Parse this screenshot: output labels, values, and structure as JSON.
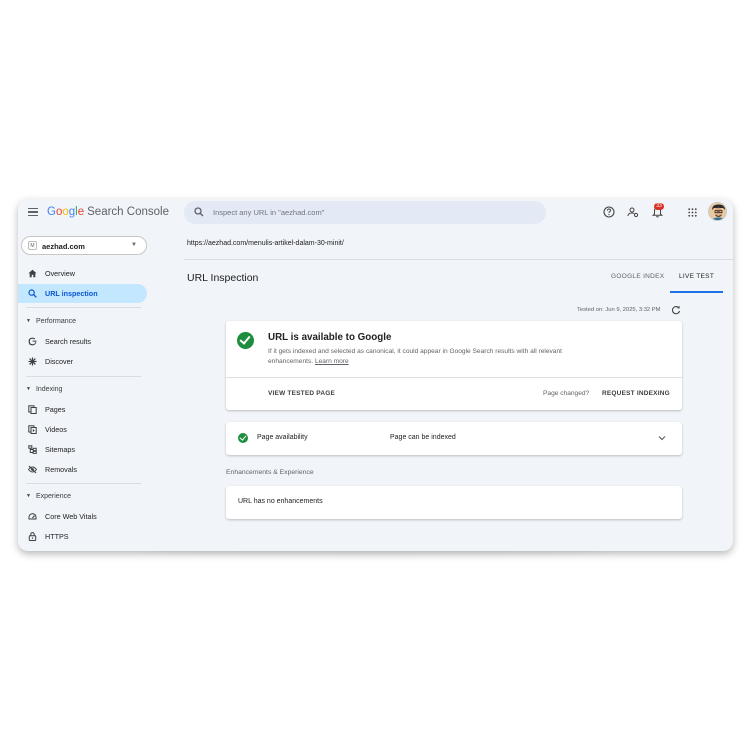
{
  "header": {
    "logo_letters": [
      "G",
      "o",
      "o",
      "g",
      "l",
      "e"
    ],
    "logo_product": "Search Console",
    "search_placeholder": "Inspect any URL in \"aezhad.com\"",
    "notification_count": "33"
  },
  "sidebar": {
    "property": "aezhad.com",
    "property_icon_letter": "M",
    "items": [
      {
        "label": "Overview"
      },
      {
        "label": "URL inspection"
      }
    ],
    "sections": [
      {
        "label": "Performance",
        "items": [
          {
            "label": "Search results"
          },
          {
            "label": "Discover"
          }
        ]
      },
      {
        "label": "Indexing",
        "items": [
          {
            "label": "Pages"
          },
          {
            "label": "Videos"
          },
          {
            "label": "Sitemaps"
          },
          {
            "label": "Removals"
          }
        ]
      },
      {
        "label": "Experience",
        "items": [
          {
            "label": "Core Web Vitals"
          },
          {
            "label": "HTTPS"
          }
        ]
      }
    ]
  },
  "main": {
    "url": "https://aezhad.com/menulis-artikel-dalam-30-minit/",
    "page_title": "URL Inspection",
    "tabs": [
      {
        "label": "GOOGLE INDEX"
      },
      {
        "label": "LIVE TEST"
      }
    ],
    "active_tab": "LIVE TEST",
    "tested_on": "Tested on: Jun 9, 2025, 3:32 PM",
    "status_card": {
      "title": "URL is available to Google",
      "description": "If it gets indexed and selected as canonical, it could appear in Google Search results with all relevant enhancements.",
      "learn_more": "Learn more",
      "view_tested_page": "VIEW TESTED PAGE",
      "page_changed": "Page changed?",
      "request_indexing": "REQUEST INDEXING"
    },
    "availability": {
      "label": "Page availability",
      "value": "Page can be indexed"
    },
    "enhancements": {
      "title": "Enhancements & Experience",
      "empty": "URL has no enhancements"
    }
  },
  "colors": {
    "accent": "#1a73e8",
    "active_nav_bg": "#c2e7ff",
    "success": "#1e8e3e",
    "badge": "#d93025"
  }
}
